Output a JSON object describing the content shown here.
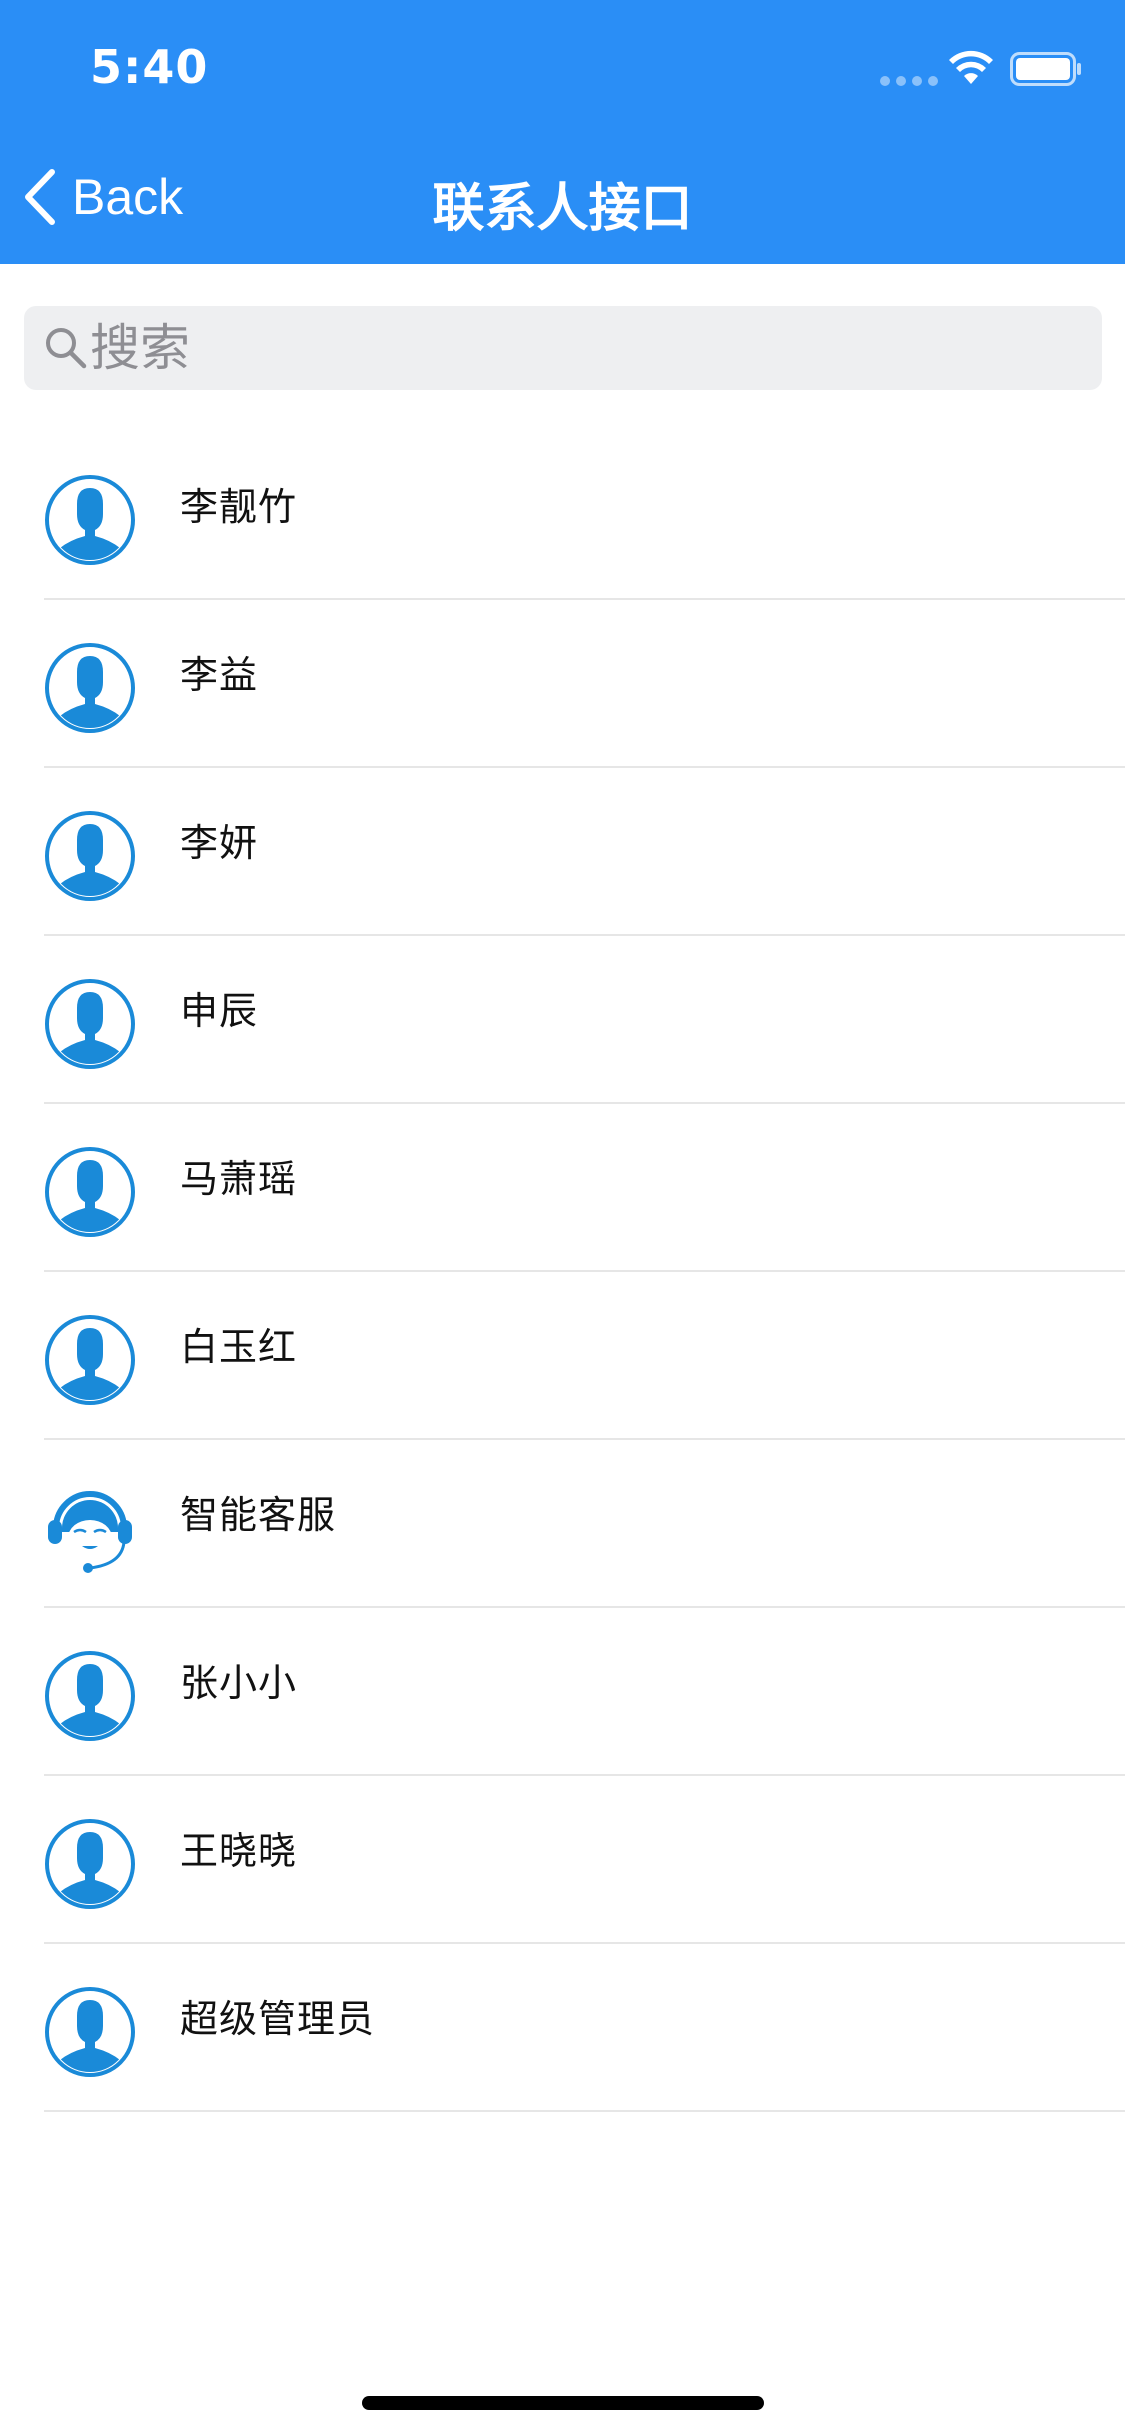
{
  "status_bar": {
    "time": "5:40"
  },
  "nav": {
    "back_label": "Back",
    "title": "联系人接口"
  },
  "search": {
    "placeholder": "搜索"
  },
  "contacts": [
    {
      "name": "李靓竹",
      "avatar": "person-avatar-icon"
    },
    {
      "name": "李益",
      "avatar": "person-avatar-icon"
    },
    {
      "name": "李妍",
      "avatar": "person-avatar-icon"
    },
    {
      "name": "申辰",
      "avatar": "person-avatar-icon"
    },
    {
      "name": "马萧瑶",
      "avatar": "person-avatar-icon"
    },
    {
      "name": "白玉红",
      "avatar": "person-avatar-icon"
    },
    {
      "name": "智能客服",
      "avatar": "customer-service-avatar-icon"
    },
    {
      "name": "张小小",
      "avatar": "person-avatar-icon"
    },
    {
      "name": "王晓晓",
      "avatar": "person-avatar-icon"
    },
    {
      "name": "超级管理员",
      "avatar": "person-avatar-icon"
    }
  ],
  "colors": {
    "header": "#2a8ef6",
    "avatar": "#1a8ad8",
    "search_bg": "#eeeff1",
    "divider": "#e6e6e6"
  }
}
